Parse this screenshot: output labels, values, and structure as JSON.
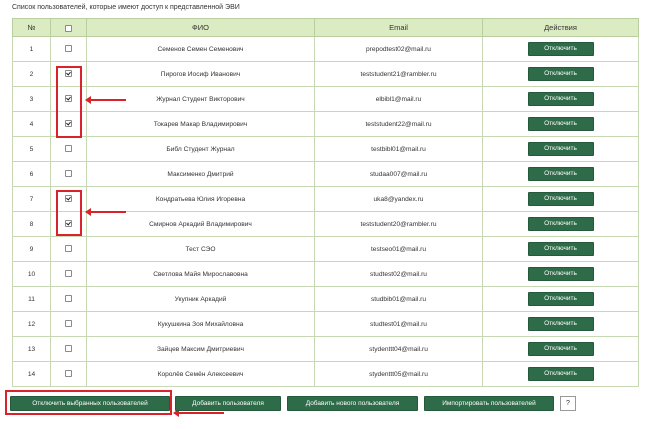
{
  "caption": "Список пользователей, которые имеют доступ к представленной ЭВИ",
  "table": {
    "headers": {
      "num": "№",
      "fio": "ФИО",
      "email": "Email",
      "actions": "Действия"
    },
    "rows": [
      {
        "num": "1",
        "checked": false,
        "fio": "Семенов Семен Семенович",
        "email": "prepodtest02@mail.ru",
        "action": "Отключить"
      },
      {
        "num": "2",
        "checked": true,
        "fio": "Пирогов Иосиф Иванович",
        "email": "teststudent21@rambler.ru",
        "action": "Отключить"
      },
      {
        "num": "3",
        "checked": true,
        "fio": "Журнал Студент Викторович",
        "email": "elbibl1@mail.ru",
        "action": "Отключить"
      },
      {
        "num": "4",
        "checked": true,
        "fio": "Токарев Макар Владимирович",
        "email": "teststudent22@mail.ru",
        "action": "Отключить"
      },
      {
        "num": "5",
        "checked": false,
        "fio": "Библ Студент Журнал",
        "email": "testbibl01@mail.ru",
        "action": "Отключить"
      },
      {
        "num": "6",
        "checked": false,
        "fio": "Максименко Дмитрий",
        "email": "studaa007@mail.ru",
        "action": "Отключить"
      },
      {
        "num": "7",
        "checked": true,
        "fio": "Кондратьева Юлия Игоревна",
        "email": "uka8@yandex.ru",
        "action": "Отключить"
      },
      {
        "num": "8",
        "checked": true,
        "fio": "Смирнов Аркадий Владимирович",
        "email": "teststudent20@rambler.ru",
        "action": "Отключить"
      },
      {
        "num": "9",
        "checked": false,
        "fio": "Тест СЭО",
        "email": "testseo01@mail.ru",
        "action": "Отключить"
      },
      {
        "num": "10",
        "checked": false,
        "fio": "Светлова Майя Мирославовна",
        "email": "studtest02@mail.ru",
        "action": "Отключить"
      },
      {
        "num": "11",
        "checked": false,
        "fio": "Укупник Аркадий",
        "email": "studbib01@mail.ru",
        "action": "Отключить"
      },
      {
        "num": "12",
        "checked": false,
        "fio": "Кукушкина Зоя Михайловна",
        "email": "studtest01@mail.ru",
        "action": "Отключить"
      },
      {
        "num": "13",
        "checked": false,
        "fio": "Зайцев Максим Дмитриевич",
        "email": "stydenttt04@mail.ru",
        "action": "Отключить"
      },
      {
        "num": "14",
        "checked": false,
        "fio": "Королёв Семён Алексеевич",
        "email": "stydenttt05@mail.ru",
        "action": "Отключить"
      }
    ]
  },
  "buttons": {
    "disable_selected": "Отключить выбранных пользователей",
    "add_user": "Добавить пользователя",
    "add_new_user": "Добавить нового пользователя",
    "import_users": "Импортировать пользователей",
    "help": "?"
  },
  "colors": {
    "header_bg": "#dcecc2",
    "button_bg": "#2e6b48",
    "highlight": "#d9222a"
  }
}
